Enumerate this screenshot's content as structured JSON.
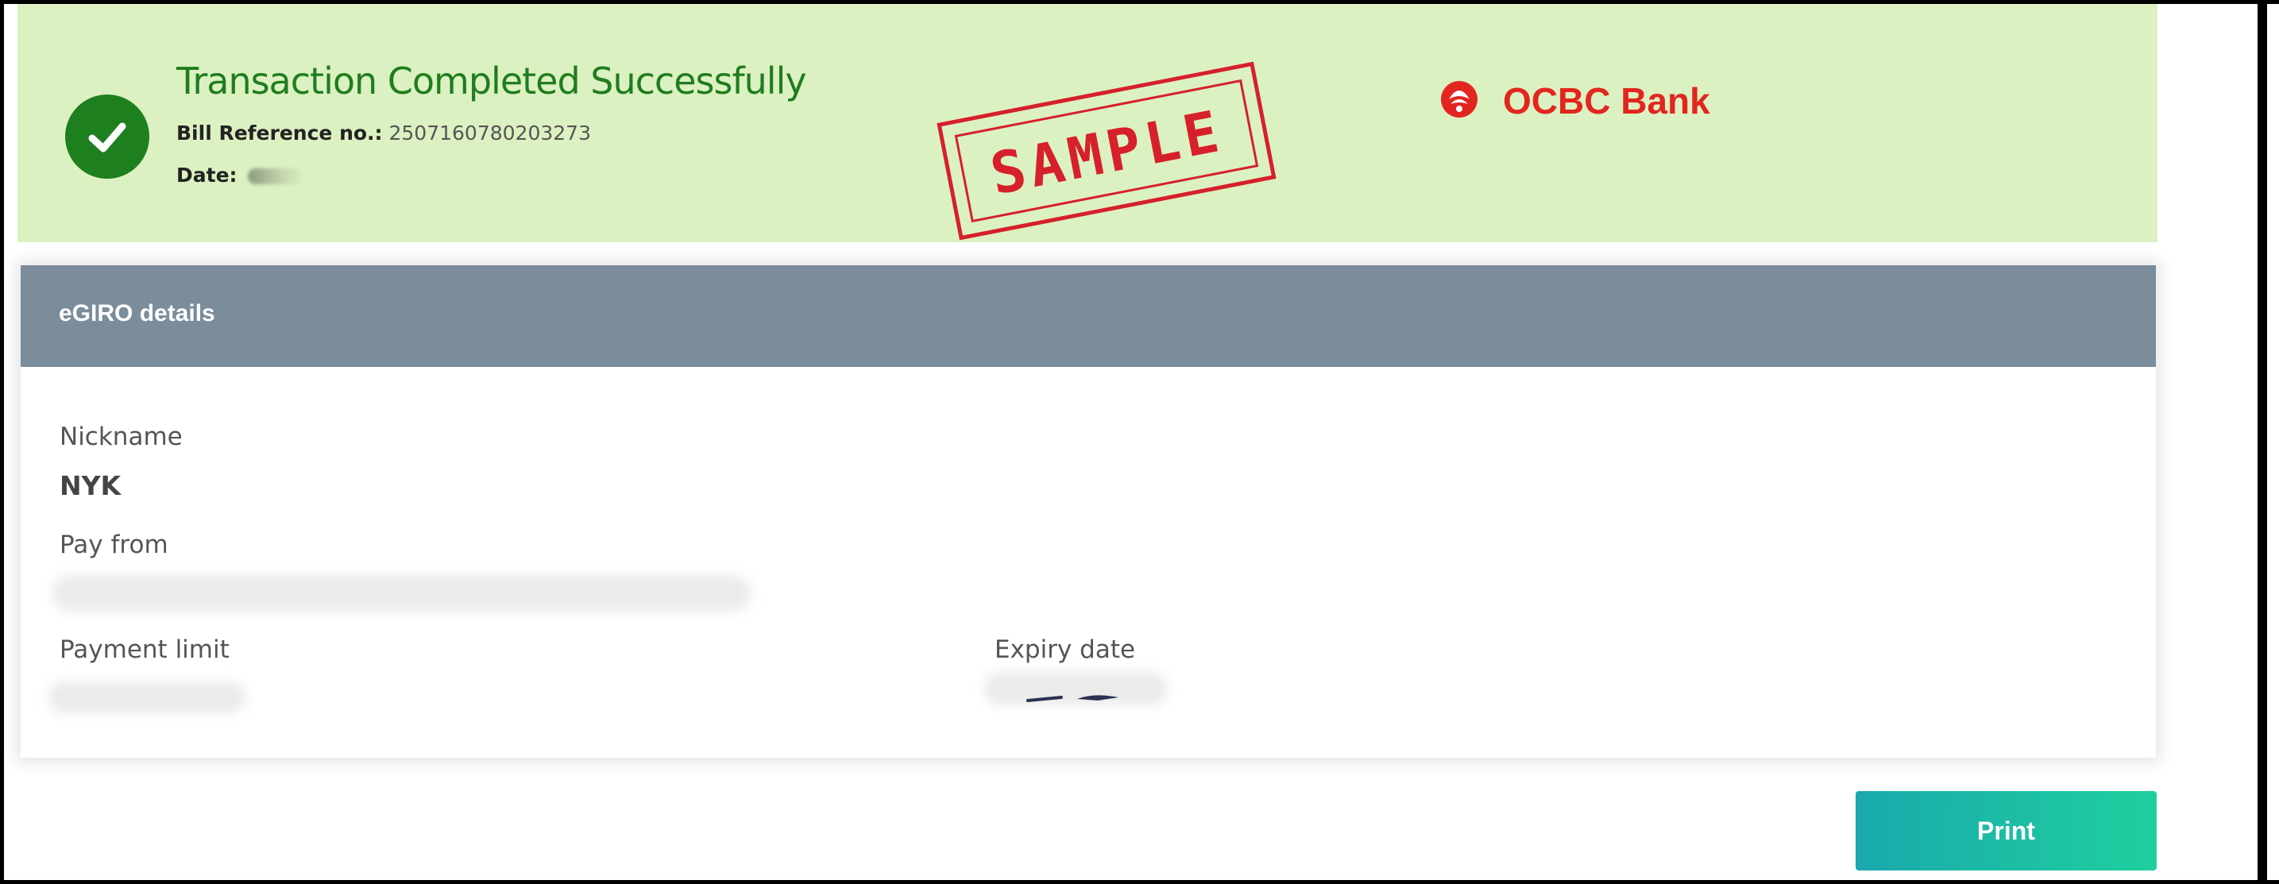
{
  "banner": {
    "title": "Transaction Completed Successfully",
    "bill_ref_label": "Bill Reference no.:",
    "bill_ref_value": "2507160780203273",
    "date_label": "Date:",
    "stamp_text": "SAMPLE",
    "brand_name": "OCBC Bank",
    "colors": {
      "banner_bg": "#dcf1c1",
      "title": "#1f7d1f",
      "check": "#1e7f1f",
      "stamp": "#d6202c",
      "brand": "#e2261f"
    }
  },
  "card": {
    "header_title": "eGIRO details",
    "header_color": "#7b8c9a",
    "fields": {
      "nickname_label": "Nickname",
      "nickname_value": "NYK",
      "pay_from_label": "Pay from",
      "payment_limit_label": "Payment limit",
      "expiry_date_label": "Expiry date"
    }
  },
  "actions": {
    "print_label": "Print",
    "print_color": "#1fb8a5"
  },
  "icons": {
    "check": "check-circle-icon",
    "logo": "ocbc-logo-icon"
  }
}
